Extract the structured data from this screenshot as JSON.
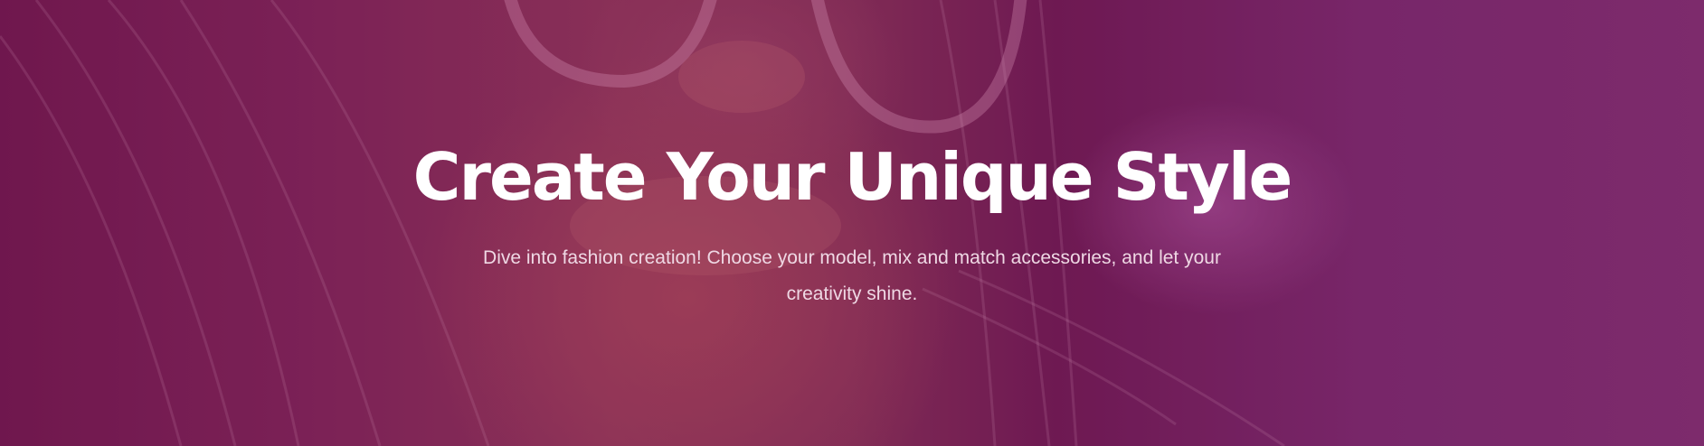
{
  "hero": {
    "title": "Create Your Unique Style",
    "subtitle": "Dive into fashion creation! Choose your model, mix and match accessories, and let your creativity shine.",
    "background_image": "woman-with-sunglasses-photo",
    "overlay_color": "#7a1f5c"
  }
}
